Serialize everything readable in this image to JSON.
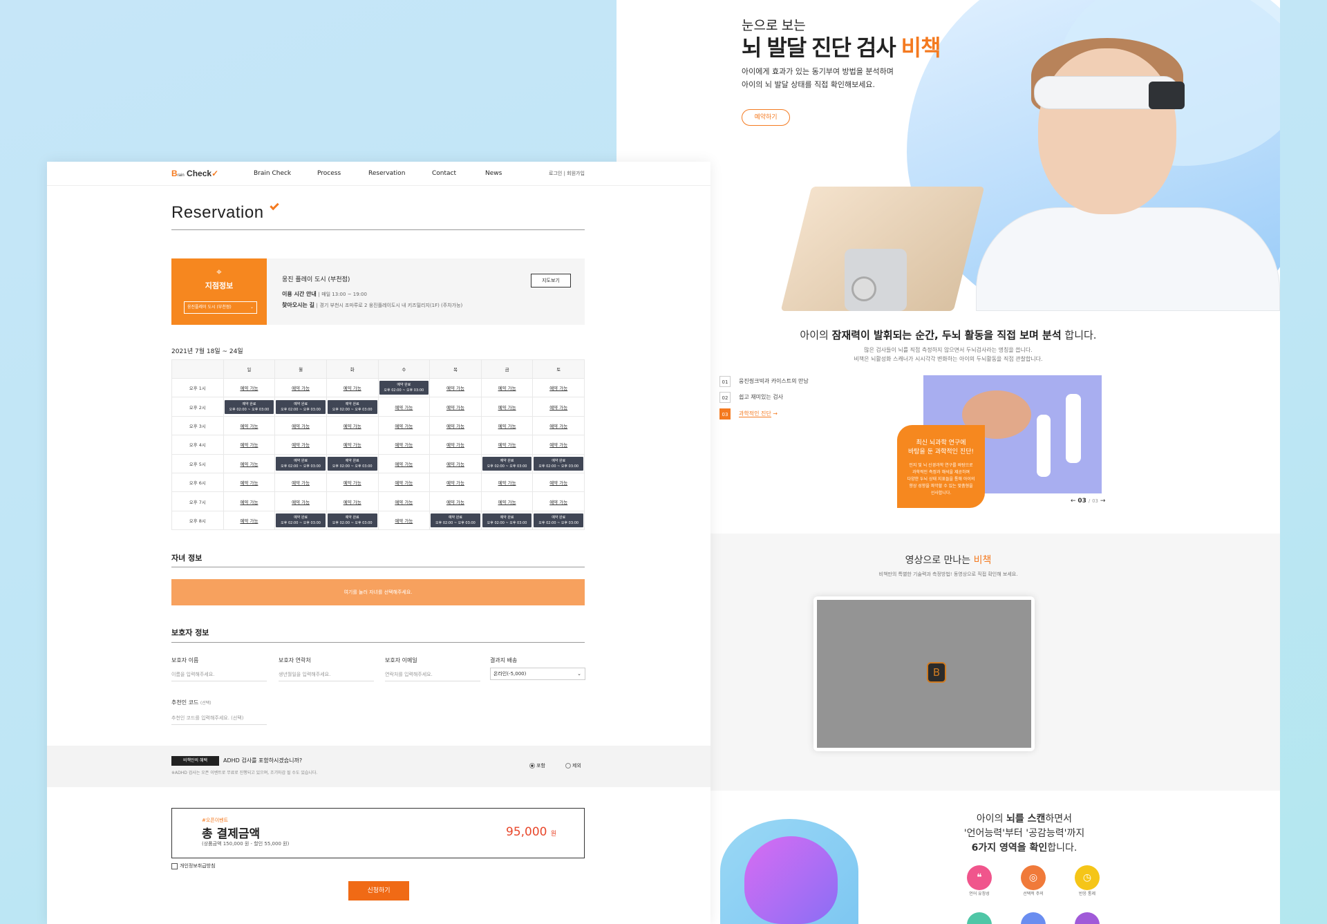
{
  "right": {
    "hero": {
      "subtitle": "눈으로 보는",
      "title_pre": "뇌 발달 진단 검사 ",
      "title_accent": "비책",
      "desc1": "아이에게 효과가 있는 동기부여 방법을 분석하며",
      "desc2": "아이의 뇌 발달 상태를 직접 확인해보세요.",
      "button": "예약하기"
    },
    "sec2": {
      "title_pre": "아이의 ",
      "title_bold": "잠재력이 발휘되는 순간, 두뇌 활동을 직접 보며 분석",
      "title_post": " 합니다.",
      "desc1": "많은 검사들이 뇌를 직접 측정하지 않으면서 두뇌검사라는 명칭을 씁니다.",
      "desc2": "비책은 뇌활성화 스캐너가 시시각각 변화하는 아이의 두뇌활동을 직접 관찰합니다.",
      "items": [
        {
          "num": "01",
          "label": "웅진씽크빅과 카이스트의 만남"
        },
        {
          "num": "02",
          "label": "쉽고 재미있는 검사"
        },
        {
          "num": "03",
          "label": "과학적인 진단"
        }
      ],
      "box_title1": "최신 뇌과학 연구에",
      "box_title2": "바탕을 둔 과학적인 진단!",
      "box_text1": "인지 및 뇌 신경과학 연구를 바탕으로",
      "box_text2": "과학적인 측정과 해석을 제공하며",
      "box_text3": "다양한 두뇌 상태 지표들을 통해 아이의",
      "box_text4": "향상 성향을 파악할 수 있는 맞춤형을",
      "box_text5": "선사합니다.",
      "pager_current": "03",
      "pager_total": "03"
    },
    "sec3": {
      "title_pre": "영상으로 만나는 ",
      "title_accent": "비책",
      "desc": "비책만의 특별한 기술력과 측정방법! 동영상으로 직접 확인해 보세요."
    },
    "sec4": {
      "line1_pre": "아이의 ",
      "line1_bold": "뇌를 스캔",
      "line1_post": "하면서",
      "line2": "'언어능력'부터 '공감능력'까지",
      "line3_bold": "6가지 영역을 확인",
      "line3_post": "합니다.",
      "icons": [
        {
          "label": "언어 유창성",
          "color": "#f0558c",
          "icon": "speech-icon"
        },
        {
          "label": "선택적 주의",
          "color": "#f07a3a",
          "icon": "target-icon"
        },
        {
          "label": "반응 통제",
          "color": "#f5c518",
          "icon": "clock-icon"
        }
      ]
    }
  },
  "left": {
    "nav": {
      "logo_b": "B",
      "logo_rain": "rain",
      "logo_check": "Check",
      "items": [
        "Brain Check",
        "Process",
        "Reservation",
        "Contact",
        "News"
      ],
      "login": "로그인",
      "sep": "|",
      "join": "회원가입"
    },
    "title": "Reservation",
    "shop": {
      "label": "지점정보",
      "select": "웅진플레이 도시 (부천점)",
      "name": "웅진 플레이 도시 (부천점)",
      "hours_label": "이용 시간 안내",
      "hours_value": "매일 13:00 ~ 19:00",
      "dir_label": "찾아오시는 길",
      "dir_value": "경기 부천시 조마루로 2 웅진플레이도시 내 키즈밀리지(1F) (주차가능)",
      "map_button": "지도보기"
    },
    "calendar": {
      "week": "2021년 7월 18일 ~ 24일",
      "days": [
        "일",
        "월",
        "화",
        "수",
        "목",
        "금",
        "토"
      ],
      "avail": "예약 가능",
      "done": "예약 완료",
      "slot": "오후 02:00 ~ 오후 03:00",
      "rows": [
        {
          "time": "오후 1시",
          "cells": [
            0,
            0,
            0,
            1,
            0,
            0,
            0
          ]
        },
        {
          "time": "오후 2시",
          "cells": [
            1,
            1,
            1,
            0,
            0,
            0,
            0
          ]
        },
        {
          "time": "오후 3시",
          "cells": [
            0,
            0,
            0,
            0,
            0,
            0,
            0
          ]
        },
        {
          "time": "오후 4시",
          "cells": [
            0,
            0,
            0,
            0,
            0,
            0,
            0
          ]
        },
        {
          "time": "오후 5시",
          "cells": [
            0,
            1,
            1,
            0,
            0,
            1,
            1
          ]
        },
        {
          "time": "오후 6시",
          "cells": [
            0,
            0,
            0,
            0,
            0,
            0,
            0
          ]
        },
        {
          "time": "오후 7시",
          "cells": [
            0,
            0,
            0,
            0,
            0,
            0,
            0
          ]
        },
        {
          "time": "오후 8시",
          "cells": [
            0,
            1,
            1,
            0,
            1,
            1,
            1
          ]
        }
      ]
    },
    "child": {
      "title": "자녀 정보",
      "bar": "여기를 눌러 자녀를 선택해주세요."
    },
    "guardian": {
      "title": "보호자 정보",
      "name_label": "보호자 이름",
      "name_ph": "이름을 입력해주세요.",
      "phone_label": "보호자 연락처",
      "phone_ph": "생년월일을 입력해주세요.",
      "email_label": "보호자 이메일",
      "email_ph": "연락처를 입력해주세요.",
      "result_label": "결과지 배송",
      "result_value": "온라인(-5,000)",
      "code_label": "추천인 코드",
      "code_opt": "(선택)",
      "code_ph": "추천인 코드를 입력해주세요. (선택)"
    },
    "adhd": {
      "badge": "비책만의 혜택",
      "question": "ADHD 검사를 포함하시겠습니까?",
      "note": "※ADHD 검사는 오픈 이벤트로 무료로 진행되고 있으며, 조기마감 될 수도 있습니다.",
      "opt1": "포함",
      "opt2": "제외"
    },
    "payment": {
      "event": "#오픈이벤트",
      "title": "총 결제금액",
      "detail": "(상품금액 150,000 원 - 할인 55,000 원)",
      "price": "95,000",
      "unit": "원",
      "agree": "개인정보취급방침",
      "submit": "신청하기"
    }
  }
}
